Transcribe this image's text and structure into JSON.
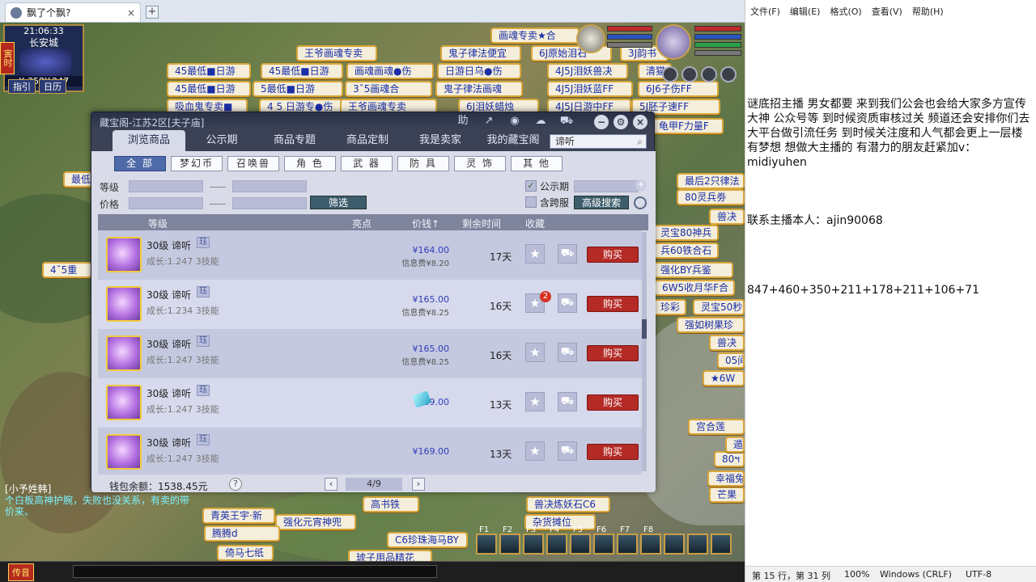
{
  "browser": {
    "tab_title": "飘了个飘?",
    "close": "×",
    "new_tab": "+"
  },
  "minimap": {
    "time": "21:06:33",
    "city": "长安城",
    "coords": "X:352Y:247",
    "btn_guide": "指引",
    "btn_calendar": "日历",
    "side_tag": "寅时"
  },
  "stalls": [
    "画魂专卖★合",
    "王爷画魂专卖",
    "鬼子律法便宜",
    "6J原始泪石",
    "3J韵书",
    "45最低■日游",
    "45最低■日游",
    "画魂画魂●伤",
    "日游日乌●伤",
    "4J5J泪妖兽决",
    "清猫",
    "45最低■日游",
    "5最低■日游",
    "3ˇ5画魂合",
    "鬼子律法画魂",
    "4J5J泪妖蓝FF",
    "6J6子伤FF",
    "吸血鬼专卖■",
    "4 5 日游专●伤",
    "王爷画魂专卖",
    "6J泪妖蜡烛",
    "4J5J日游中FF",
    "5J胚子速FF",
    "龟甲F力量F",
    "最后2只律法",
    "80灵兵劵",
    "兽决",
    "灵宝80神兵",
    "兵60铁合石",
    "强化BY兵鉴",
    "6W5收月华F合",
    "珍彩",
    "灵宝50秒",
    "强如树果珍",
    "兽决",
    "05间",
    "★6W",
    "青英王宇·新",
    "强化元宵神兜",
    "高书铁",
    "兽决炼妖石C6",
    "C6珍珠海马BY",
    "琥子用品精花",
    "4ˇ5重",
    "最低",
    "腾腾d",
    "倚马七纸",
    "杂货摊位",
    "芒果",
    "幸福兔",
    "80ฯ",
    "遁",
    "宫合莲"
  ],
  "chat": {
    "line1": "[小予姓韩]",
    "line2": "个白板高神护腕，失败也没关系，有卖的带价来。",
    "send_btn": "传音"
  },
  "skills": [
    "F1",
    "F2",
    "F3",
    "F4",
    "F5",
    "F6",
    "F7",
    "F8"
  ],
  "dialog": {
    "title": "藏宝阁-江苏2区[夫子庙]",
    "toolbar_icons": [
      "help-icon",
      "share-icon",
      "record-icon",
      "chat-icon",
      "cart-icon"
    ],
    "win_icons": [
      "minimize-icon",
      "settings-icon",
      "close-icon"
    ],
    "tabs": [
      "浏览商品",
      "公示期",
      "商品专题",
      "商品定制",
      "我是卖家",
      "我的藏宝阁"
    ],
    "search_value": "谛听",
    "categories": [
      "全 部",
      "梦幻币",
      "召唤兽",
      "角 色",
      "武 器",
      "防 具",
      "灵 饰",
      "其 他"
    ],
    "filters": {
      "level_label": "等级",
      "price_label": "价格",
      "filter_btn": "筛选",
      "publicity_label": "公示期",
      "cross_server_label": "含跨服",
      "advanced_btn": "高级搜索"
    },
    "headers": {
      "level": "等级",
      "highlight": "亮点",
      "price": "价钱↑",
      "time_left": "剩余时间",
      "favorite": "收藏"
    },
    "rows": [
      {
        "name": "30级 谛听",
        "badge": "珏",
        "growth": "成长:1.247 3技能",
        "price": "¥164.00",
        "fee": "信息费¥8.20",
        "time": "17天",
        "buy": "购买"
      },
      {
        "name": "30级 谛听",
        "badge": "珏",
        "growth": "成长:1.234 3技能",
        "price": "¥165.00",
        "fee": "信息费¥8.25",
        "time": "16天",
        "buy": "购买",
        "fav_count": "2"
      },
      {
        "name": "30级 谛听",
        "badge": "珏",
        "growth": "成长:1.247 3技能",
        "price": "¥165.00",
        "fee": "信息费¥8.25",
        "time": "16天",
        "buy": "购买"
      },
      {
        "name": "30级 谛听",
        "badge": "珏",
        "growth": "成长:1.247 3技能",
        "price": "169.00",
        "fee": "",
        "time": "13天",
        "buy": "购买"
      },
      {
        "name": "30级 谛听",
        "badge": "珏",
        "growth": "成长:1.247 3技能",
        "price": "¥169.00",
        "fee": "",
        "time": "13天",
        "buy": "购买"
      }
    ],
    "wallet": "钱包余额：1538.45元",
    "pagination": {
      "prev": "‹",
      "current": "4/9",
      "next": "›"
    }
  },
  "notepad": {
    "menu": [
      "文件(F)",
      "编辑(E)",
      "格式(O)",
      "查看(V)",
      "帮助(H)"
    ],
    "para1": "谜底招主播 男女都要 来到我们公会也会给大家多方宣传大神 公众号等  到时候资质审核过关 频道还会安排你们去大平台做引流任务 到时候关注度和人气都会更上一层楼 有梦想 想做大主播的 有潜力的朋友赶紧加v：midiyuhen",
    "para2": "联系主播本人：ajin90068",
    "para3": "847+460+350+211+178+211+106+71",
    "status": {
      "position": "第 15 行，第 31 列",
      "zoom": "100%",
      "line_ending": "Windows (CRLF)",
      "encoding": "UTF-8"
    }
  },
  "colors": {
    "accent_red": "#b42a25",
    "dialog_bg": "#3b4256",
    "price_blue": "#2f3cb8"
  }
}
